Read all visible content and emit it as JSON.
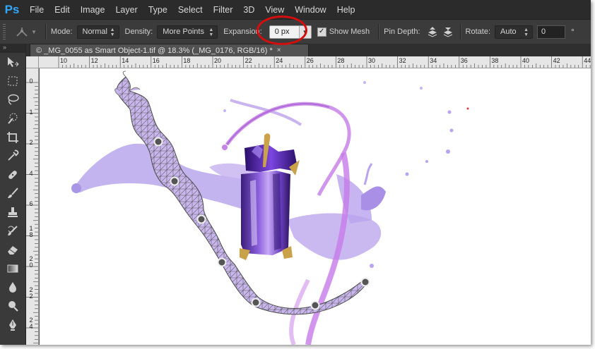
{
  "app": {
    "logo": "Ps"
  },
  "menu": [
    "File",
    "Edit",
    "Image",
    "Layer",
    "Type",
    "Select",
    "Filter",
    "3D",
    "View",
    "Window",
    "Help"
  ],
  "options": {
    "mode_label": "Mode:",
    "mode_value": "Normal",
    "density_label": "Density:",
    "density_value": "More Points",
    "expansion_label": "Expansion:",
    "expansion_value": "0 px",
    "show_mesh_label": "Show Mesh",
    "show_mesh_checked": "✓",
    "pin_depth_label": "Pin Depth:",
    "rotate_label": "Rotate:",
    "rotate_value": "Auto",
    "angle_value": "0",
    "degree_symbol": "°"
  },
  "document": {
    "tab_title": "© _MG_0055 as Smart Object-1.tif @ 18.3% (_MG_0176, RGB/16) *",
    "close_glyph": "×"
  },
  "ruler": {
    "horizontal": [
      "10",
      "12",
      "14",
      "16",
      "18",
      "20",
      "22",
      "24",
      "26",
      "28",
      "30",
      "32",
      "34",
      "36",
      "38",
      "40",
      "42",
      "44"
    ],
    "vertical": [
      "0",
      "1",
      "2",
      "4",
      "6",
      "8",
      "0",
      "2",
      "4",
      "6"
    ],
    "vertical_major": [
      "",
      "",
      "",
      "",
      "",
      "1",
      "2",
      "2",
      "2",
      ""
    ]
  },
  "tools": [
    "move-tool",
    "marquee-tool",
    "lasso-tool",
    "quick-selection-tool",
    "crop-tool",
    "eyedropper-tool",
    "healing-brush-tool",
    "brush-tool",
    "clone-stamp-tool",
    "history-brush-tool",
    "eraser-tool",
    "gradient-tool",
    "blur-tool",
    "dodge-tool",
    "pen-tool"
  ],
  "colors": {
    "ui_dark": "#2b2b2b",
    "panel": "#3b3b3b",
    "accent": "#31a8ff",
    "highlight_ring": "#d60d0d",
    "liquid": "#a98fe6",
    "bottle": "#6a3fb8"
  }
}
